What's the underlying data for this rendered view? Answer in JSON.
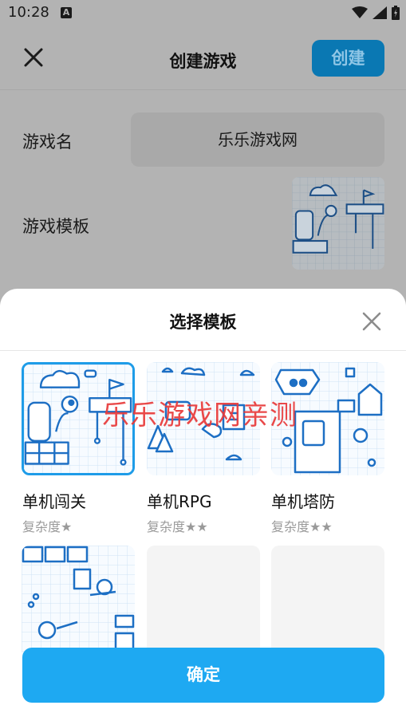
{
  "status_bar": {
    "time": "10:28",
    "notif_badge": "A"
  },
  "header": {
    "title": "创建游戏",
    "create_label": "创建"
  },
  "form": {
    "name_label": "游戏名",
    "name_value": "乐乐游戏网",
    "template_label": "游戏模板"
  },
  "sheet": {
    "title": "选择模板",
    "templates": [
      {
        "name": "单机闯关",
        "difficulty": "复杂度★"
      },
      {
        "name": "单机RPG",
        "difficulty": "复杂度★★"
      },
      {
        "name": "单机塔防",
        "difficulty": "复杂度★★"
      }
    ],
    "confirm_label": "确定"
  },
  "watermark": "乐乐游戏网亲测",
  "colors": {
    "accent": "#1ea9f2",
    "sketch": "#1d6fc4",
    "selected_border": "#1e9ce8"
  }
}
